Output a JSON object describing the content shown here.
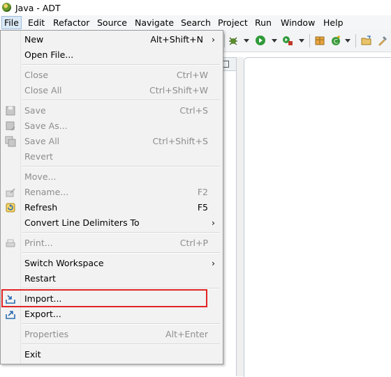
{
  "window": {
    "title": "Java - ADT"
  },
  "menubar": {
    "file": "File",
    "edit": "Edit",
    "refactor": "Refactor",
    "source": "Source",
    "navigate": "Navigate",
    "search": "Search",
    "project": "Project",
    "run": "Run",
    "window": "Window",
    "help": "Help"
  },
  "file_menu": {
    "new": {
      "label": "New",
      "shortcut": "Alt+Shift+N"
    },
    "open_file": {
      "label": "Open File..."
    },
    "close": {
      "label": "Close",
      "shortcut": "Ctrl+W"
    },
    "close_all": {
      "label": "Close All",
      "shortcut": "Ctrl+Shift+W"
    },
    "save": {
      "label": "Save",
      "shortcut": "Ctrl+S"
    },
    "save_as": {
      "label": "Save As..."
    },
    "save_all": {
      "label": "Save All",
      "shortcut": "Ctrl+Shift+S"
    },
    "revert": {
      "label": "Revert"
    },
    "move": {
      "label": "Move..."
    },
    "rename": {
      "label": "Rename...",
      "shortcut": "F2"
    },
    "refresh": {
      "label": "Refresh",
      "shortcut": "F5"
    },
    "convert": {
      "label": "Convert Line Delimiters To"
    },
    "print": {
      "label": "Print...",
      "shortcut": "Ctrl+P"
    },
    "switch_workspace": {
      "label": "Switch Workspace"
    },
    "restart": {
      "label": "Restart"
    },
    "import": {
      "label": "Import..."
    },
    "export": {
      "label": "Export..."
    },
    "properties": {
      "label": "Properties",
      "shortcut": "Alt+Enter"
    },
    "exit": {
      "label": "Exit"
    },
    "submenu_arrow": "›"
  },
  "colors": {
    "highlight_border": "#e02424",
    "disabled_text": "#8d8d8d"
  }
}
